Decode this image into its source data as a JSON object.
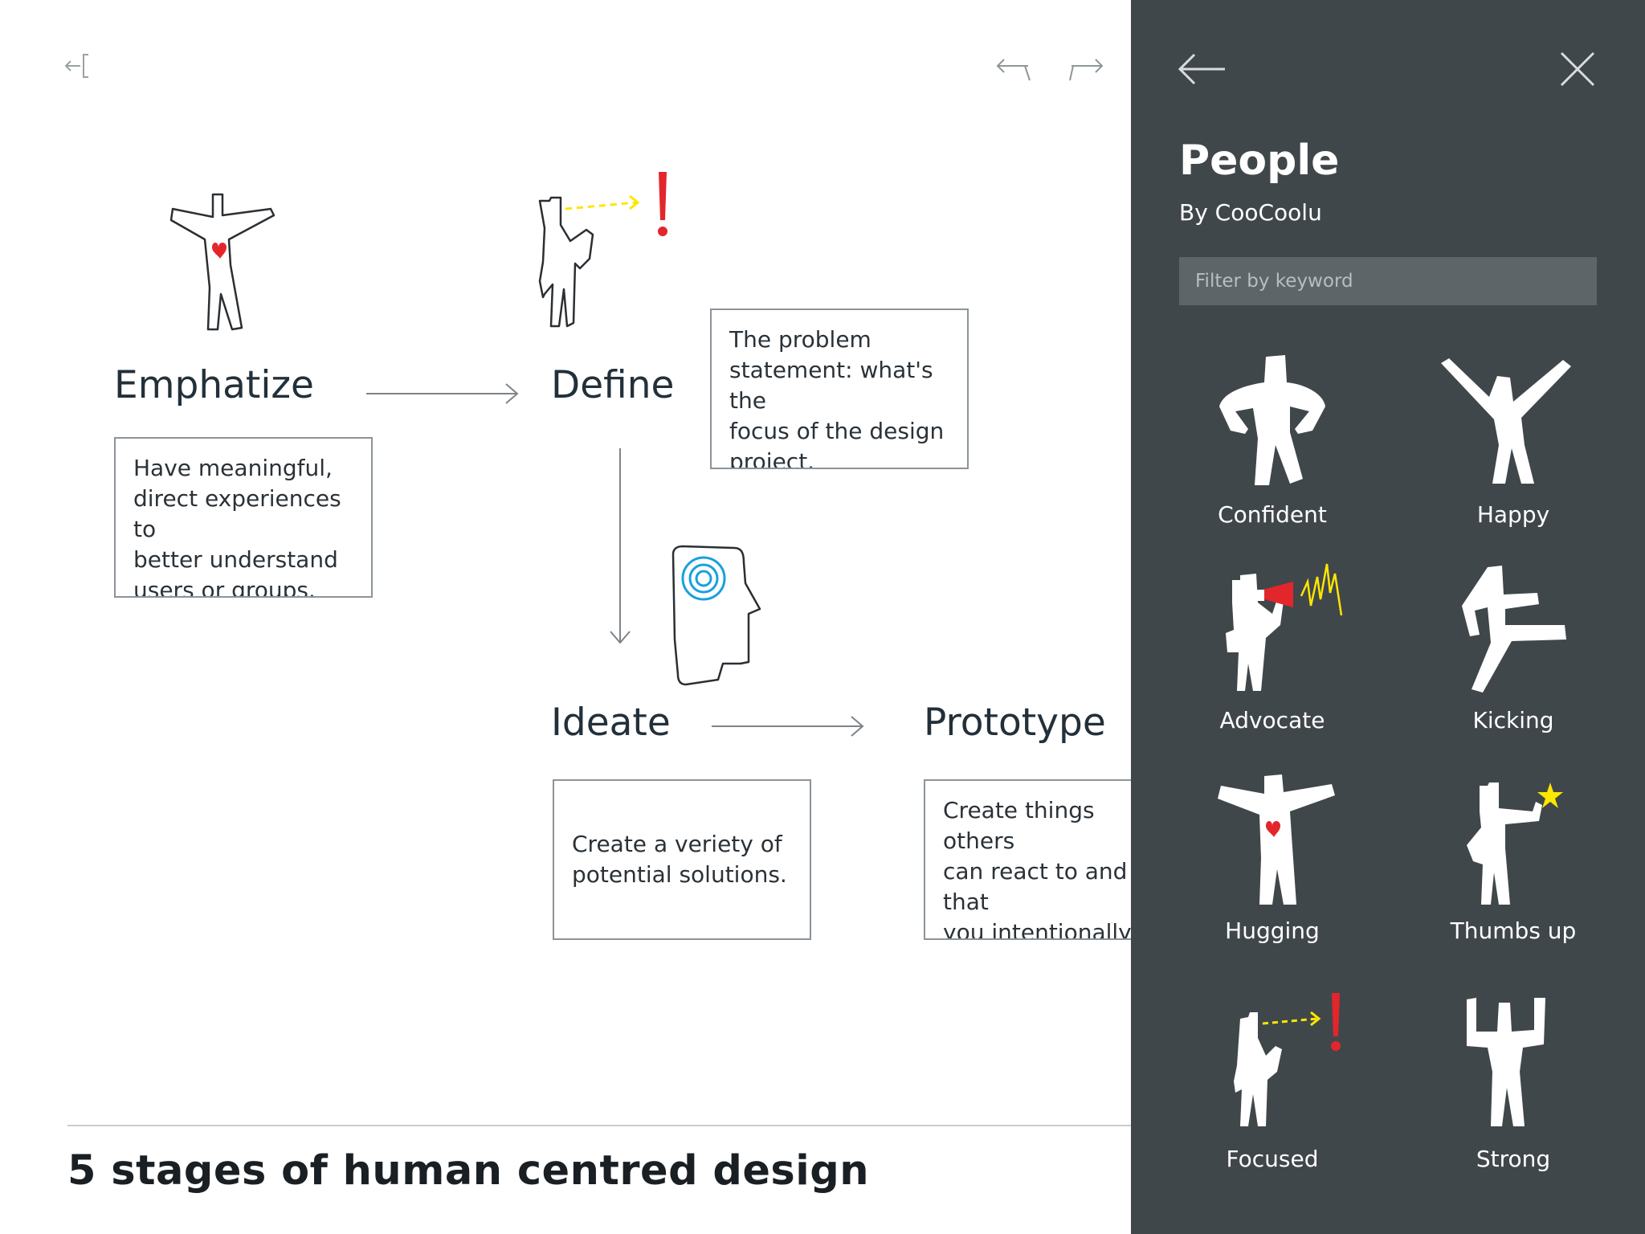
{
  "toolbar": {
    "collapse_icon": "collapse-panel-icon",
    "undo_icon": "undo-icon",
    "redo_icon": "redo-icon"
  },
  "canvas": {
    "stages": [
      {
        "title": "Emphatize",
        "description": "Have meaningful,\ndirect experiences to\nbetter understand\nusers or groups."
      },
      {
        "title": "Define",
        "description": "The problem\nstatement: what's the\nfocus of the design\nproject."
      },
      {
        "title": "Ideate",
        "description": "Create a veriety of\npotential solutions."
      },
      {
        "title": "Prototype",
        "description": "Create things others\ncan react to and that\nyou intentionally hold\nas non-precious."
      }
    ],
    "document_title": "5 stages of human centred design"
  },
  "panel": {
    "title": "People",
    "author": "By CooCoolu",
    "filter_placeholder": "Filter by keyword",
    "back_icon": "back-arrow-icon",
    "close_icon": "close-icon",
    "items": [
      {
        "label": "Confident",
        "icon": "confident-figure-icon"
      },
      {
        "label": "Happy",
        "icon": "happy-figure-icon"
      },
      {
        "label": "Advocate",
        "icon": "advocate-figure-icon"
      },
      {
        "label": "Kicking",
        "icon": "kicking-figure-icon"
      },
      {
        "label": "Hugging",
        "icon": "hugging-figure-icon"
      },
      {
        "label": "Thumbs up",
        "icon": "thumbs-up-figure-icon"
      },
      {
        "label": "Focused",
        "icon": "focused-figure-icon"
      },
      {
        "label": "Strong",
        "icon": "strong-figure-icon"
      }
    ]
  },
  "colors": {
    "panel_bg": "#40474b",
    "accent_red": "#e3262b",
    "accent_yellow": "#ffe600",
    "accent_blue": "#1aa0dc"
  }
}
